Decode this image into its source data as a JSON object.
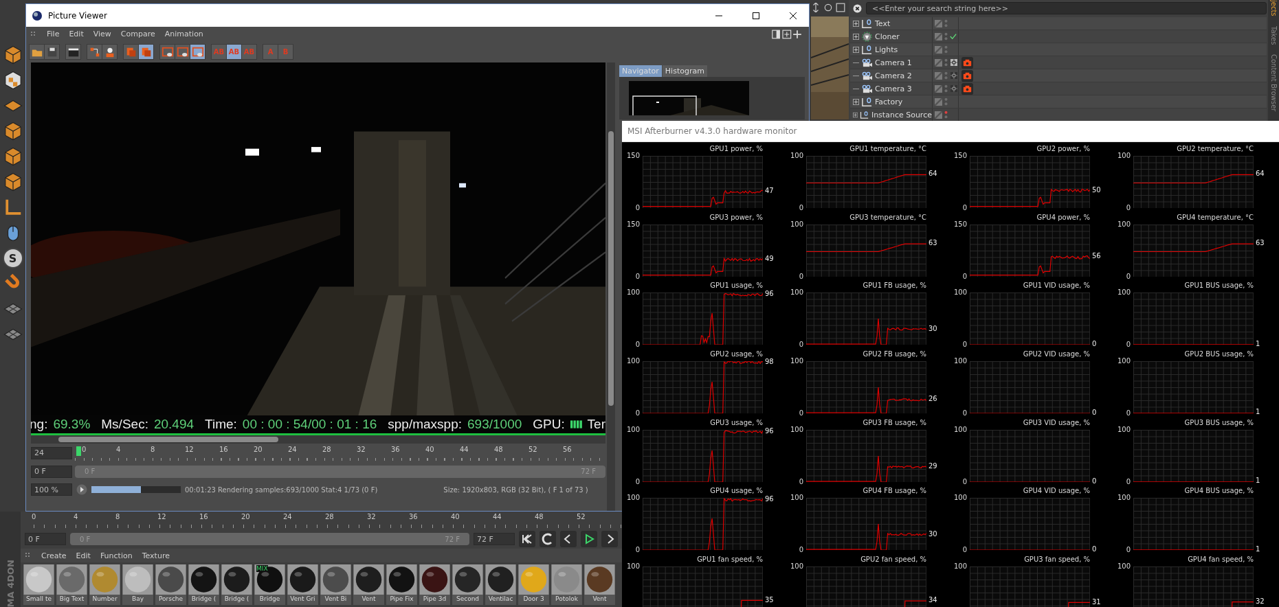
{
  "left_toolbar": [
    {
      "kind": "cube"
    },
    {
      "kind": "checker"
    },
    {
      "kind": "plane"
    },
    {
      "kind": "cube"
    },
    {
      "kind": "cube"
    },
    {
      "kind": "cube"
    },
    {
      "kind": "axis"
    },
    {
      "kind": "mouse"
    },
    {
      "kind": "letter",
      "glyph": "S"
    },
    {
      "kind": "magnet"
    },
    {
      "kind": "grid"
    },
    {
      "kind": "grid"
    }
  ],
  "picture_viewer": {
    "title": "Picture Viewer",
    "menu": [
      "File",
      "Edit",
      "View",
      "Compare",
      "Animation"
    ],
    "toolbar": [
      [
        {
          "kind": "folder",
          "selected": false
        },
        {
          "kind": "disk",
          "selected": false
        }
      ],
      [
        {
          "kind": "clapper",
          "selected": false
        }
      ],
      [
        {
          "kind": "nodes",
          "selected": false
        },
        {
          "kind": "user",
          "selected": false
        }
      ],
      [
        {
          "kind": "layers",
          "selected": false
        },
        {
          "kind": "layers",
          "selected": true
        }
      ],
      [
        {
          "kind": "frame",
          "selected": false
        },
        {
          "kind": "frame",
          "selected": false
        },
        {
          "kind": "frame",
          "selected": true
        }
      ],
      [
        {
          "kind": "glyph",
          "glyph": "AB",
          "selected": false
        },
        {
          "kind": "glyph",
          "glyph": "AB",
          "selected": true
        },
        {
          "kind": "glyph",
          "glyph": "AB",
          "selected": false
        }
      ],
      [
        {
          "kind": "glyph",
          "glyph": "A",
          "selected": false
        },
        {
          "kind": "glyph",
          "glyph": "B",
          "selected": false
        }
      ]
    ],
    "tabs": [
      {
        "label": "Navigator",
        "selected": true
      },
      {
        "label": "Histogram",
        "selected": false
      }
    ],
    "stats": [
      {
        "label": "ng:",
        "value": "69.3%"
      },
      {
        "label": "Ms/Sec:",
        "value": "20.494"
      },
      {
        "label": "Time:",
        "value": "00 : 00 : 54/00 : 01 : 16"
      },
      {
        "label": "spp/maxspp:",
        "value": "693/1000"
      },
      {
        "label": "GPU:",
        "kind": "gpu"
      },
      {
        "label": "Ter"
      }
    ],
    "fps": "24",
    "ticks": [
      "0",
      "4",
      "8",
      "12",
      "16",
      "20",
      "24",
      "28",
      "32",
      "36",
      "40",
      "44",
      "48",
      "52",
      "56"
    ],
    "frame": "0 F",
    "range": {
      "start": "0 F",
      "end": "72 F",
      "level": 1
    },
    "zoom": "100 %",
    "progress": {
      "level": 0.55
    },
    "status_text": "00:01:23 Rendering samples:693/1000 Stat:4 1/73 (0 F)",
    "size_text": "Size: 1920x803, RGB (32 Bit),  ( F 1 of 73 )"
  },
  "object_manager": {
    "search": {
      "placeholder": "<<Enter your search string here>>"
    },
    "objects": [
      {
        "name": "Text",
        "kind": "null",
        "expandable": true,
        "checked": false,
        "color": "#6e6e6e"
      },
      {
        "name": "Cloner",
        "kind": "cloner",
        "expandable": true,
        "checked": true,
        "color": "#6e6e6e"
      },
      {
        "name": "Lights",
        "kind": "null",
        "expandable": true,
        "checked": false,
        "color": "#6e6e6e"
      },
      {
        "name": "Camera 1",
        "kind": "camera",
        "expandable": false,
        "checked": false,
        "color": "#6e6e6e",
        "tags": [
          {
            "kind": "target",
            "active": true
          },
          {
            "kind": "camera",
            "active": true
          }
        ]
      },
      {
        "name": "Camera 2",
        "kind": "camera",
        "expandable": false,
        "checked": false,
        "color": "#6e6e6e",
        "tags": [
          {
            "kind": "target",
            "active": false
          },
          {
            "kind": "camera",
            "active": true
          }
        ]
      },
      {
        "name": "Camera 3",
        "kind": "camera",
        "expandable": false,
        "checked": false,
        "color": "#6e6e6e",
        "tags": [
          {
            "kind": "target",
            "active": false
          },
          {
            "kind": "camera",
            "active": true
          }
        ]
      },
      {
        "name": "Factory",
        "kind": "null",
        "expandable": true,
        "checked": false,
        "color": "#6e6e6e"
      },
      {
        "name": "Instance Source",
        "kind": "null",
        "expandable": true,
        "checked": false,
        "color": "#e04040"
      }
    ],
    "side_tabs": [
      {
        "label": "jects",
        "selected": true
      },
      {
        "label": "Takes",
        "selected": false
      },
      {
        "label": "Content Browser",
        "selected": false
      }
    ]
  },
  "afterburner": {
    "title": "MSI Afterburner v4.3.0 hardware monitor",
    "graphs": [
      {
        "title": "GPU1 power, %",
        "kind": "power",
        "ymax": "150",
        "ymin": "0",
        "value": "47"
      },
      {
        "title": "GPU1 temperature, °C",
        "kind": "temperature",
        "ymax": "100",
        "ymin": "0",
        "value": "64"
      },
      {
        "title": "GPU2 power, %",
        "kind": "power",
        "ymax": "150",
        "ymin": "0",
        "value": "50"
      },
      {
        "title": "GPU2 temperature, °C",
        "kind": "temperature",
        "ymax": "100",
        "ymin": "0",
        "value": "64"
      },
      {
        "title": "GPU3 power, %",
        "kind": "power",
        "ymax": "150",
        "ymin": "0",
        "value": "49"
      },
      {
        "title": "GPU3 temperature, °C",
        "kind": "temperature",
        "ymax": "100",
        "ymin": "0",
        "value": "63"
      },
      {
        "title": "GPU4 power, %",
        "kind": "power",
        "ymax": "150",
        "ymin": "0",
        "value": "56"
      },
      {
        "title": "GPU4 temperature, °C",
        "kind": "temperature",
        "ymax": "100",
        "ymin": "0",
        "value": "63"
      },
      {
        "title": "GPU1 usage, %",
        "kind": "usage",
        "ymax": "100",
        "ymin": "0",
        "value": "96"
      },
      {
        "title": "GPU1 FB usage, %",
        "kind": "fb",
        "ymax": "100",
        "ymin": "0",
        "value": "30"
      },
      {
        "title": "GPU1 VID usage, %",
        "kind": "flat",
        "ymax": "100",
        "ymin": "0",
        "value": "0"
      },
      {
        "title": "GPU1 BUS usage, %",
        "kind": "flat",
        "ymax": "100",
        "ymin": "0",
        "value": "1"
      },
      {
        "title": "GPU2 usage, %",
        "kind": "usage",
        "ymax": "100",
        "ymin": "0",
        "value": "98"
      },
      {
        "title": "GPU2 FB usage, %",
        "kind": "fb",
        "ymax": "100",
        "ymin": "0",
        "value": "26"
      },
      {
        "title": "GPU2 VID usage, %",
        "kind": "flat",
        "ymax": "100",
        "ymin": "0",
        "value": "0"
      },
      {
        "title": "GPU2 BUS usage, %",
        "kind": "flat",
        "ymax": "100",
        "ymin": "0",
        "value": "1"
      },
      {
        "title": "GPU3 usage, %",
        "kind": "usage",
        "ymax": "100",
        "ymin": "0",
        "value": "96"
      },
      {
        "title": "GPU3 FB usage, %",
        "kind": "fb",
        "ymax": "100",
        "ymin": "0",
        "value": "29"
      },
      {
        "title": "GPU3 VID usage, %",
        "kind": "flat",
        "ymax": "100",
        "ymin": "0",
        "value": "0"
      },
      {
        "title": "GPU3 BUS usage, %",
        "kind": "flat",
        "ymax": "100",
        "ymin": "0",
        "value": "1"
      },
      {
        "title": "GPU4 usage, %",
        "kind": "usage",
        "ymax": "100",
        "ymin": "0",
        "value": "96"
      },
      {
        "title": "GPU4 FB usage, %",
        "kind": "fb",
        "ymax": "100",
        "ymin": "0",
        "value": "30"
      },
      {
        "title": "GPU4 VID usage, %",
        "kind": "flat",
        "ymax": "100",
        "ymin": "0",
        "value": "0"
      },
      {
        "title": "GPU4 BUS usage, %",
        "kind": "flat",
        "ymax": "100",
        "ymin": "0",
        "value": "1"
      },
      {
        "title": "GPU1 fan speed, %",
        "kind": "fan",
        "ymax": "100",
        "value": "35"
      },
      {
        "title": "GPU2 fan speed, %",
        "kind": "fan",
        "ymax": "100",
        "value": "34"
      },
      {
        "title": "GPU3 fan speed, %",
        "kind": "fan",
        "ymax": "100",
        "value": "31"
      },
      {
        "title": "GPU4 fan speed, %",
        "kind": "fan",
        "ymax": "100",
        "value": "32"
      }
    ]
  },
  "timeline": {
    "ticks": [
      "0",
      "4",
      "8",
      "12",
      "16",
      "20",
      "24",
      "28",
      "32",
      "36",
      "40",
      "44",
      "48",
      "52"
    ],
    "frame": "0 F",
    "range": {
      "start": "0 F",
      "end": "72 F",
      "level": 1
    },
    "end_frame": "72 F"
  },
  "material_manager": {
    "menu": [
      "Create",
      "Edit",
      "Function",
      "Texture"
    ],
    "materials": [
      {
        "name": "Small te",
        "color": "#c8c8c8"
      },
      {
        "name": "Big Text",
        "color": "#6a6a6a"
      },
      {
        "name": "Number",
        "color": "#b08a30"
      },
      {
        "name": "Bay",
        "color": "#bdbdbd"
      },
      {
        "name": "Porsche",
        "color": "#4a4a4a"
      },
      {
        "name": "Bridge (",
        "color": "#141414"
      },
      {
        "name": "Bridge (",
        "color": "#1c1c1c"
      },
      {
        "name": "Bridge",
        "color": "#101010",
        "badge": "MIX"
      },
      {
        "name": "Vent Gri",
        "color": "#1a1a1a"
      },
      {
        "name": "Vent Bi",
        "color": "#4c4c4c"
      },
      {
        "name": "Vent",
        "color": "#1e1e1e"
      },
      {
        "name": "Pipe Fix",
        "color": "#121212"
      },
      {
        "name": "Pipe 3d",
        "color": "#3a1414"
      },
      {
        "name": "Second",
        "color": "#262626"
      },
      {
        "name": "Ventilac",
        "color": "#202020"
      },
      {
        "name": "Door 3",
        "color": "#e0a81a"
      },
      {
        "name": "Potolok",
        "color": "#8a8a8a"
      },
      {
        "name": "Vent",
        "color": "#5a3a22"
      }
    ]
  },
  "logo_lines": [
    "ON",
    "MA 4D"
  ]
}
